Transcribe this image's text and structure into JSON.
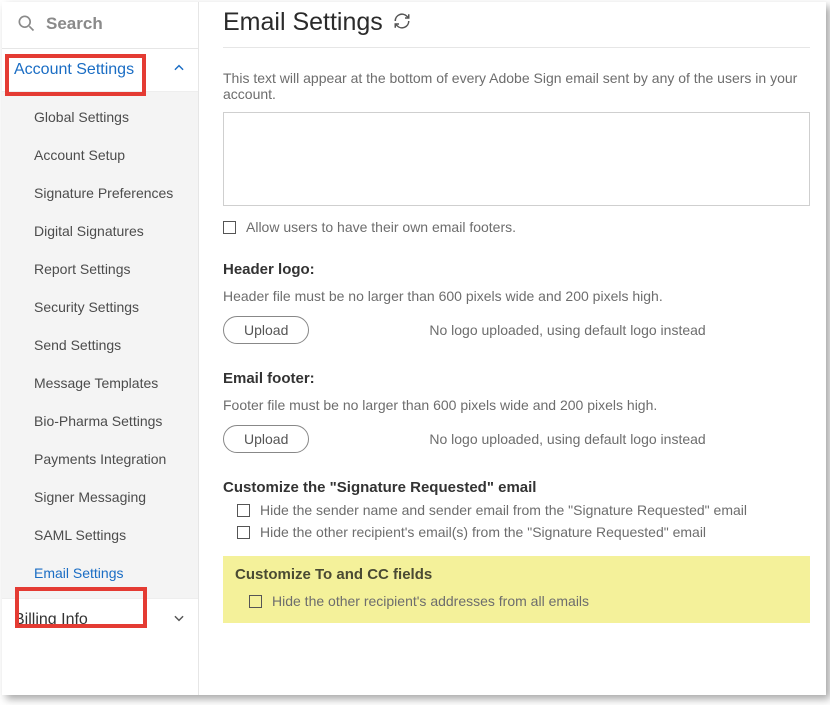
{
  "search": {
    "placeholder": "Search"
  },
  "sidebar": {
    "accountSettings": {
      "label": "Account Settings",
      "items": [
        "Global Settings",
        "Account Setup",
        "Signature Preferences",
        "Digital Signatures",
        "Report Settings",
        "Security Settings",
        "Send Settings",
        "Message Templates",
        "Bio-Pharma Settings",
        "Payments Integration",
        "Signer Messaging",
        "SAML Settings",
        "Email Settings"
      ]
    },
    "billingInfo": {
      "label": "Billing Info"
    }
  },
  "page": {
    "title": "Email Settings",
    "footerDesc": "This text will appear at the bottom of every Adobe Sign email sent by any of the users in your account.",
    "allowOwnFooters": "Allow users to have their own email footers.",
    "headerLogo": {
      "title": "Header logo:",
      "hint": "Header file must be no larger than 600 pixels wide and 200 pixels high.",
      "uploadLabel": "Upload",
      "status": "No logo uploaded, using default logo instead"
    },
    "emailFooter": {
      "title": "Email footer:",
      "hint": "Footer file must be no larger than 600 pixels wide and 200 pixels high.",
      "uploadLabel": "Upload",
      "status": "No logo uploaded, using default logo instead"
    },
    "customizeSigReq": {
      "title": "Customize the \"Signature Requested\" email",
      "opt1": "Hide the sender name and sender email from the \"Signature Requested\" email",
      "opt2": "Hide the other recipient's email(s) from the \"Signature Requested\" email"
    },
    "customizeToCc": {
      "title": "Customize To and CC fields",
      "opt1": "Hide the other recipient's addresses from all emails"
    }
  }
}
